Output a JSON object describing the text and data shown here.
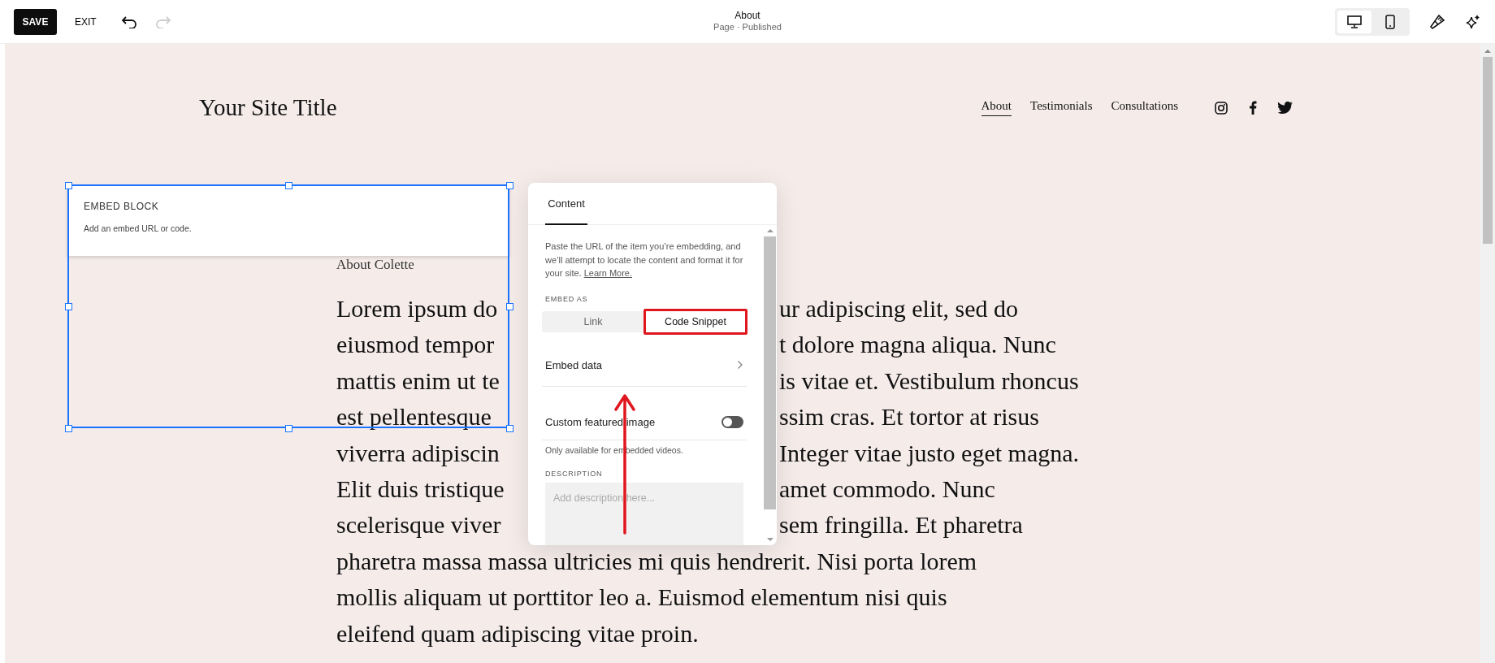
{
  "toolbar": {
    "save": "SAVE",
    "exit": "EXIT",
    "undo": {
      "disabled": false
    },
    "redo": {
      "disabled": true
    },
    "title": "About",
    "subtitle": "Page · Published",
    "devices": [
      {
        "kind": "desktop",
        "selected": true
      },
      {
        "kind": "mobile",
        "selected": false
      }
    ]
  },
  "site": {
    "title": "Your Site Title",
    "nav": [
      {
        "label": "About",
        "selected": true
      },
      {
        "label": "Testimonials",
        "selected": false
      },
      {
        "label": "Consultations",
        "selected": false
      }
    ]
  },
  "embed_block": {
    "label": "EMBED BLOCK",
    "hint": "Add an embed URL or code."
  },
  "page": {
    "heading": "About Colette",
    "lines": [
      [
        "Lorem ipsum do",
        "ur adipiscing elit, sed do"
      ],
      [
        "eiusmod tempor",
        "t dolore magna aliqua. Nunc"
      ],
      [
        "mattis enim ut te",
        "is vitae et. Vestibulum rhoncus"
      ],
      [
        "est pellentesque",
        "ssim cras. Et tortor at risus"
      ],
      [
        "viverra adipiscin",
        "Integer vitae justo eget magna."
      ],
      [
        "Elit duis tristique",
        "amet commodo. Nunc"
      ],
      [
        "scelerisque viver",
        "sem fringilla. Et pharetra"
      ],
      [
        "pharetra massa massa ultricies mi quis hendrerit. Nisi porta lorem"
      ],
      [
        "mollis aliquam ut porttitor leo a. Euismod elementum nisi quis"
      ],
      [
        "eleifend quam adipiscing vitae proin."
      ]
    ]
  },
  "panel": {
    "tabs": [
      {
        "label": "Content",
        "selected": true
      }
    ],
    "intro": "Paste the URL of the item you’re embedding, and we’ll attempt to locate the content and format it for your site.",
    "link": "Learn More.",
    "embed_as": "EMBED AS",
    "options": [
      {
        "label": "Link",
        "selected": false,
        "highlighted": false
      },
      {
        "label": "Code Snippet",
        "selected": true,
        "highlighted": true
      }
    ],
    "embed_data": "Embed data",
    "custom_image": {
      "label": "Custom featured image",
      "on": false
    },
    "note": "Only available for embedded videos.",
    "description": "DESCRIPTION",
    "placeholder": "Add description here..."
  }
}
